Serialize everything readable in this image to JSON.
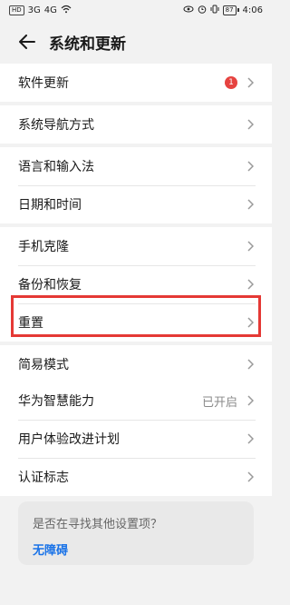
{
  "status_bar": {
    "left": [
      "HD",
      "3G",
      "4G",
      "WiFi"
    ],
    "battery": "87",
    "time": "4:06"
  },
  "header": {
    "title": "系统和更新"
  },
  "groups": [
    [
      {
        "label": "软件更新",
        "badge": "1",
        "value": ""
      }
    ],
    [
      {
        "label": "系统导航方式",
        "badge": "",
        "value": ""
      }
    ],
    [
      {
        "label": "语言和输入法",
        "badge": "",
        "value": ""
      },
      {
        "label": "日期和时间",
        "badge": "",
        "value": ""
      }
    ],
    [
      {
        "label": "手机克隆",
        "badge": "",
        "value": ""
      },
      {
        "label": "备份和恢复",
        "badge": "",
        "value": ""
      },
      {
        "label": "重置",
        "badge": "",
        "value": ""
      }
    ],
    [
      {
        "label": "简易模式",
        "badge": "",
        "value": ""
      }
    ],
    [
      {
        "label": "华为智慧能力",
        "badge": "",
        "value": "已开启"
      },
      {
        "label": "用户体验改进计划",
        "badge": "",
        "value": ""
      },
      {
        "label": "认证标志",
        "badge": "",
        "value": ""
      }
    ]
  ],
  "help": {
    "question": "是否在寻找其他设置项？",
    "link": "无障碍"
  },
  "colors": {
    "background": "#f2f2f2",
    "highlight": "#e53935",
    "badge": "#e64340",
    "link": "#1a73e8"
  }
}
